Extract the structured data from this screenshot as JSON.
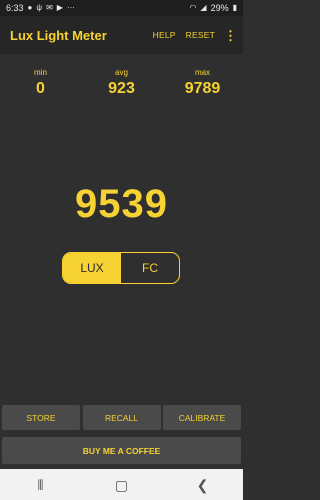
{
  "status_bar": {
    "time": "6:33",
    "left_icons": [
      "notification-icon",
      "usb-icon",
      "mail-icon",
      "youtube-icon",
      "more-icon"
    ],
    "battery": "29%"
  },
  "app_bar": {
    "title": "Lux Light Meter",
    "help_label": "HELP",
    "reset_label": "RESET"
  },
  "stats": {
    "min_label": "min",
    "min_value": "0",
    "avg_label": "avg",
    "avg_value": "923",
    "max_label": "max",
    "max_value": "9789"
  },
  "reading": "9539",
  "units": {
    "lux_label": "LUX",
    "fc_label": "FC",
    "selected": "LUX"
  },
  "buttons": {
    "store_label": "STORE",
    "recall_label": "RECALL",
    "calibrate_label": "CALIBRATE",
    "coffee_label": "BUY ME A COFFEE"
  },
  "colors": {
    "accent": "#f6d233",
    "background": "#2f2f2f",
    "button": "#4a4a4a"
  }
}
